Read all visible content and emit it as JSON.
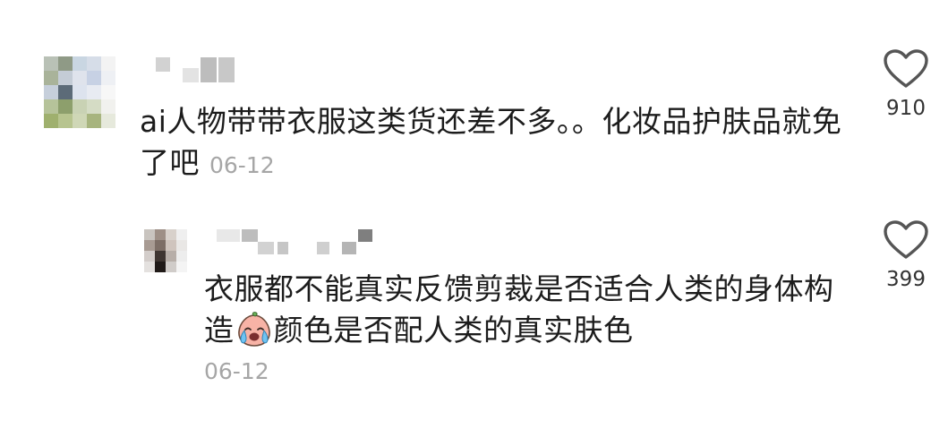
{
  "comments": [
    {
      "text": "ai人物带带衣服这类货还差不多。。化妆品护肤品就免了吧",
      "date": "06-12",
      "likes": "910"
    },
    {
      "text_before_emoji": "衣服都不能真实反馈剪裁是否适合人类的身体构造",
      "emoji": "crying-face-emoji",
      "text_after_emoji": "颜色是否配人类的真实肤色",
      "date": "06-12",
      "likes": "399"
    }
  ],
  "icons": {
    "like": "heart-outline-icon"
  },
  "colors": {
    "text": "#1c1c1c",
    "meta": "#a6a6a6",
    "icon": "#555555"
  }
}
